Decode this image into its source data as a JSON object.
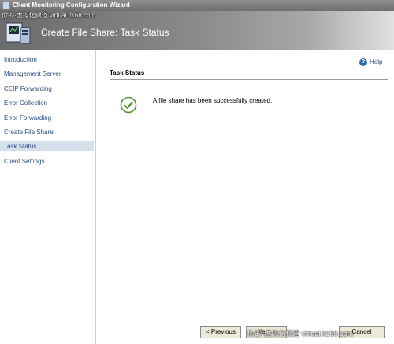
{
  "window": {
    "title": "Client Monitoring Configuration Wizard"
  },
  "header": {
    "title": "Create File Share: Task Status"
  },
  "watermark": {
    "top": "你的·虚拟化频道 virtual.it168.com",
    "bottom": "你的·虚拟化频道 virtual.it168.com"
  },
  "sidebar": {
    "items": [
      {
        "label": "Introduction"
      },
      {
        "label": "Management Server"
      },
      {
        "label": "CEIP Forwarding"
      },
      {
        "label": "Error Collection"
      },
      {
        "label": "Error Forwarding"
      },
      {
        "label": "Create File Share"
      },
      {
        "label": "Task Status",
        "active": true
      },
      {
        "label": "Client Settings"
      }
    ]
  },
  "main": {
    "help_label": "Help",
    "help_icon": "help-icon",
    "section_title": "Task Status",
    "status_icon": "success-check-icon",
    "status_message": "A file share has been successfully created."
  },
  "footer": {
    "previous_label": "< Previous",
    "next_label": "Next >",
    "cancel_label": "Cancel"
  },
  "colors": {
    "accent_link": "#2e4f86",
    "success": "#4a9a2c",
    "help": "#2f6db3"
  }
}
